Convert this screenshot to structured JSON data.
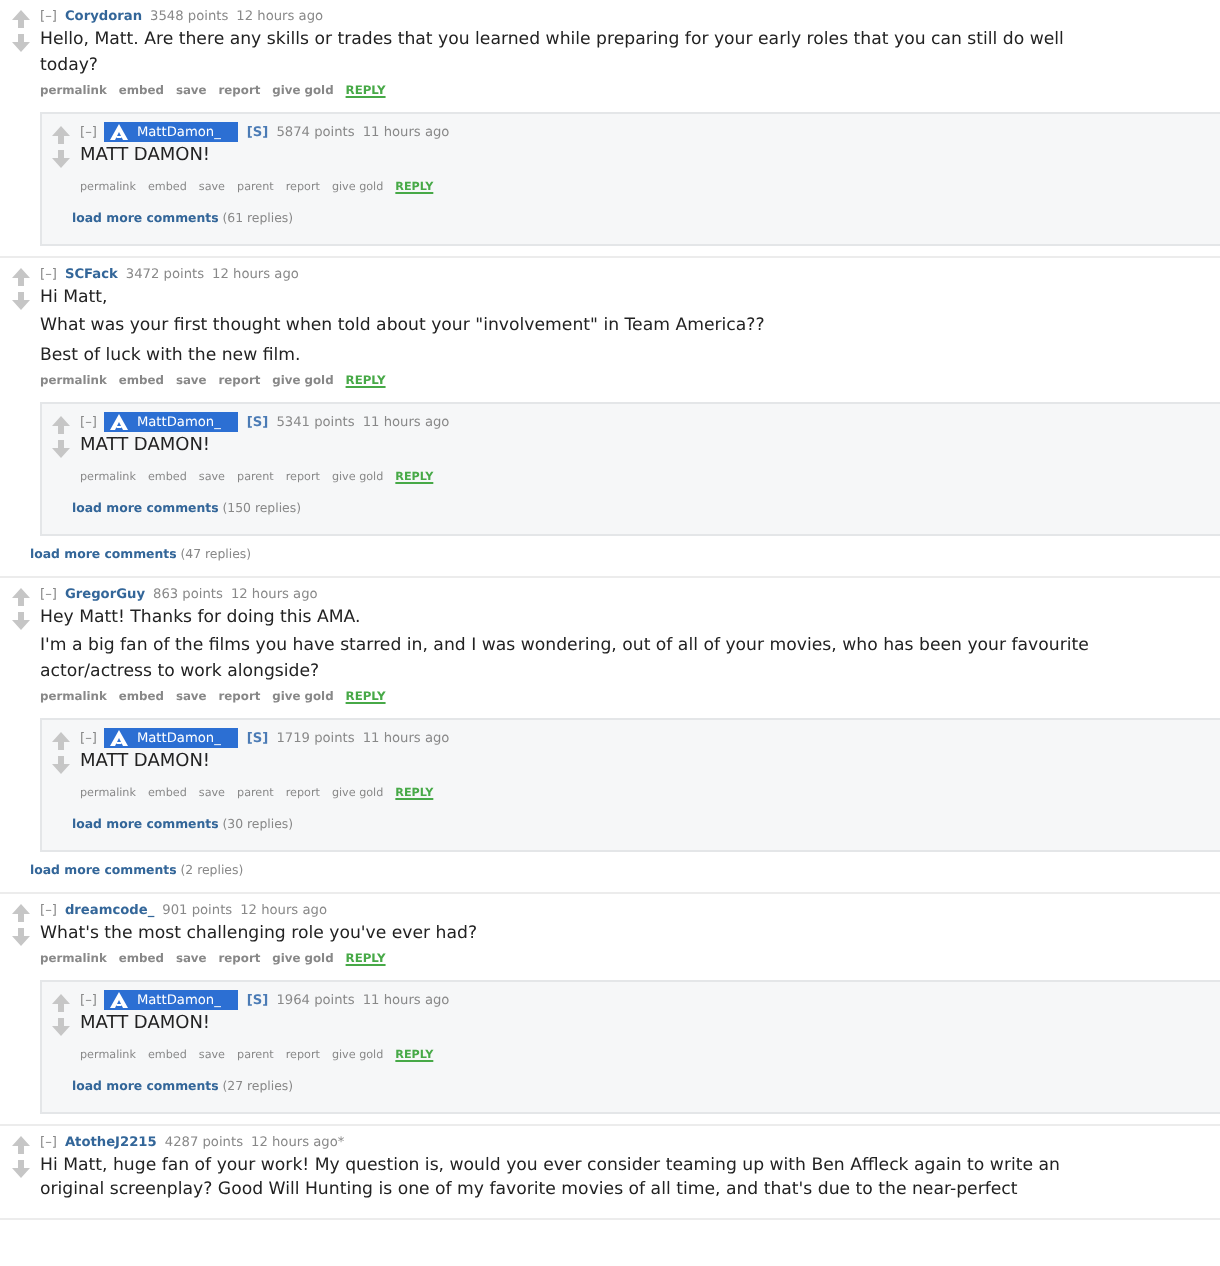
{
  "threads": [
    {
      "comment": {
        "toggle": "[–]",
        "author": "Corydoran",
        "points": "3548 points",
        "time": "12 hours ago",
        "paragraphs": [
          "Hello, Matt. Are there any skills or trades that you learned while preparing for your early roles that you can still do well today?"
        ],
        "actions": [
          "permalink",
          "embed",
          "save",
          "report",
          "give gold"
        ],
        "reply_label": "REPLY"
      },
      "reply": {
        "toggle": "[–]",
        "author": "MattDamon_",
        "badge": "[S]",
        "points": "5874 points",
        "time": "11 hours ago",
        "body": "MATT DAMON!",
        "actions": [
          "permalink",
          "embed",
          "save",
          "parent",
          "report",
          "give gold"
        ],
        "reply_label": "REPLY",
        "more_link": "load more comments",
        "more_count": "(61 replies)"
      }
    },
    {
      "comment": {
        "toggle": "[–]",
        "author": "SCFack",
        "points": "3472 points",
        "time": "12 hours ago",
        "paragraphs": [
          "Hi Matt,",
          "What was your first thought when told about your \"involvement\" in Team America??",
          "Best of luck with the new film."
        ],
        "actions": [
          "permalink",
          "embed",
          "save",
          "report",
          "give gold"
        ],
        "reply_label": "REPLY"
      },
      "reply": {
        "toggle": "[–]",
        "author": "MattDamon_",
        "badge": "[S]",
        "points": "5341 points",
        "time": "11 hours ago",
        "body": "MATT DAMON!",
        "actions": [
          "permalink",
          "embed",
          "save",
          "parent",
          "report",
          "give gold"
        ],
        "reply_label": "REPLY",
        "more_link": "load more comments",
        "more_count": "(150 replies)"
      },
      "more_link": "load more comments",
      "more_count": "(47 replies)"
    },
    {
      "comment": {
        "toggle": "[–]",
        "author": "GregorGuy",
        "points": "863 points",
        "time": "12 hours ago",
        "paragraphs": [
          "Hey Matt! Thanks for doing this AMA.",
          "I'm a big fan of the films you have starred in, and I was wondering, out of all of your movies, who has been your favourite actor/actress to work alongside?"
        ],
        "actions": [
          "permalink",
          "embed",
          "save",
          "report",
          "give gold"
        ],
        "reply_label": "REPLY"
      },
      "reply": {
        "toggle": "[–]",
        "author": "MattDamon_",
        "badge": "[S]",
        "points": "1719 points",
        "time": "11 hours ago",
        "body": "MATT DAMON!",
        "actions": [
          "permalink",
          "embed",
          "save",
          "parent",
          "report",
          "give gold"
        ],
        "reply_label": "REPLY",
        "more_link": "load more comments",
        "more_count": "(30 replies)"
      },
      "more_link": "load more comments",
      "more_count": "(2 replies)"
    },
    {
      "comment": {
        "toggle": "[–]",
        "author": "dreamcode_",
        "points": "901 points",
        "time": "12 hours ago",
        "paragraphs": [
          "What's the most challenging role you've ever had?"
        ],
        "actions": [
          "permalink",
          "embed",
          "save",
          "report",
          "give gold"
        ],
        "reply_label": "REPLY"
      },
      "reply": {
        "toggle": "[–]",
        "author": "MattDamon_",
        "badge": "[S]",
        "points": "1964 points",
        "time": "11 hours ago",
        "body": "MATT DAMON!",
        "actions": [
          "permalink",
          "embed",
          "save",
          "parent",
          "report",
          "give gold"
        ],
        "reply_label": "REPLY",
        "more_link": "load more comments",
        "more_count": "(27 replies)"
      }
    },
    {
      "comment": {
        "toggle": "[–]",
        "author": "AtotheJ2215",
        "points": "4287 points",
        "time": "12 hours ago*",
        "paragraphs": [
          "Hi Matt, huge fan of your work! My question is, would you ever consider teaming up with Ben Affleck again to write an original screenplay? Good Will Hunting is one of my favorite movies of all time, and that's due to the near-perfect"
        ]
      }
    }
  ]
}
